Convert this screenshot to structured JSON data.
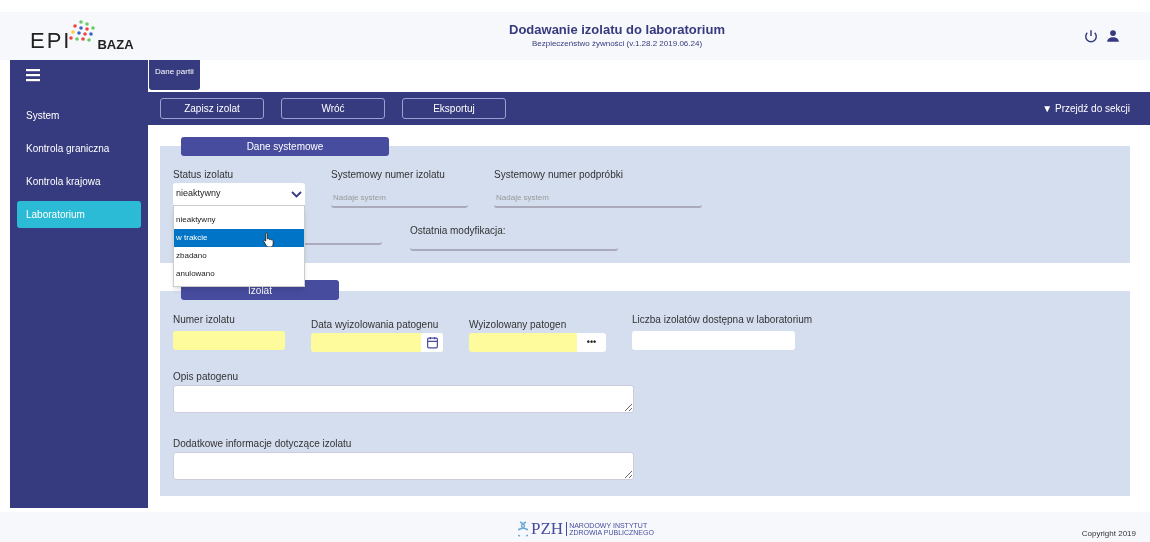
{
  "header": {
    "logo_text": "EPI",
    "logo_suffix": "BAZA",
    "title": "Dodawanie izolatu do laboratorium",
    "subtitle": "Bezpieczeństwo żywności (v.1.28.2 2019.06.24)"
  },
  "sidebar": {
    "items": [
      {
        "label": "System",
        "selected": false
      },
      {
        "label": "Kontrola graniczna",
        "selected": false
      },
      {
        "label": "Kontrola krajowa",
        "selected": false
      },
      {
        "label": "Laboratorium",
        "selected": true
      }
    ]
  },
  "tabs": [
    {
      "label": "Dane partii",
      "selected": true
    }
  ],
  "toolbar": {
    "buttons": [
      "Zapisz izolat",
      "Wróć",
      "Eksportuj"
    ],
    "section_link": "▼ Przejdź do sekcji"
  },
  "system_panel": {
    "title": "Dane systemowe",
    "status": {
      "label": "Status izolatu",
      "value": "nieaktywny",
      "expanded": true,
      "options": [
        {
          "label": "nieaktywny",
          "highlighted": false
        },
        {
          "label": "w trakcie",
          "highlighted": true
        },
        {
          "label": "zbadano",
          "highlighted": false
        },
        {
          "label": "anulowano",
          "highlighted": false
        }
      ]
    },
    "fields": [
      {
        "label": "Systemowy numer izolatu",
        "placeholder": "Nadaje system"
      },
      {
        "label": "Systemowy numer podpróbki",
        "placeholder": "Nadaje system"
      }
    ],
    "last_modified_label": "Ostatnia modyfikacja:"
  },
  "isolate_panel": {
    "title": "Izolat",
    "fields": [
      {
        "label": "Numer izolatu",
        "kind": "text",
        "required": true
      },
      {
        "label": "Data wyizolowania patogenu",
        "kind": "date",
        "required": true
      },
      {
        "label": "Wyizolowany patogen",
        "kind": "picker",
        "required": true,
        "button": "•••"
      },
      {
        "label": "Liczba izolatów dostępna w laboratorium",
        "kind": "text",
        "required": false
      }
    ],
    "textareas": [
      {
        "label": "Opis patogenu"
      },
      {
        "label": "Dodatkowe informacje dotyczące izolatu"
      }
    ]
  },
  "footer": {
    "logo_text": "PZH",
    "institute_line1": "NARODOWY INSTYTUT",
    "institute_line2": "ZDROWIA PUBLICZNEGO",
    "copyright": "Copyright 2019"
  }
}
